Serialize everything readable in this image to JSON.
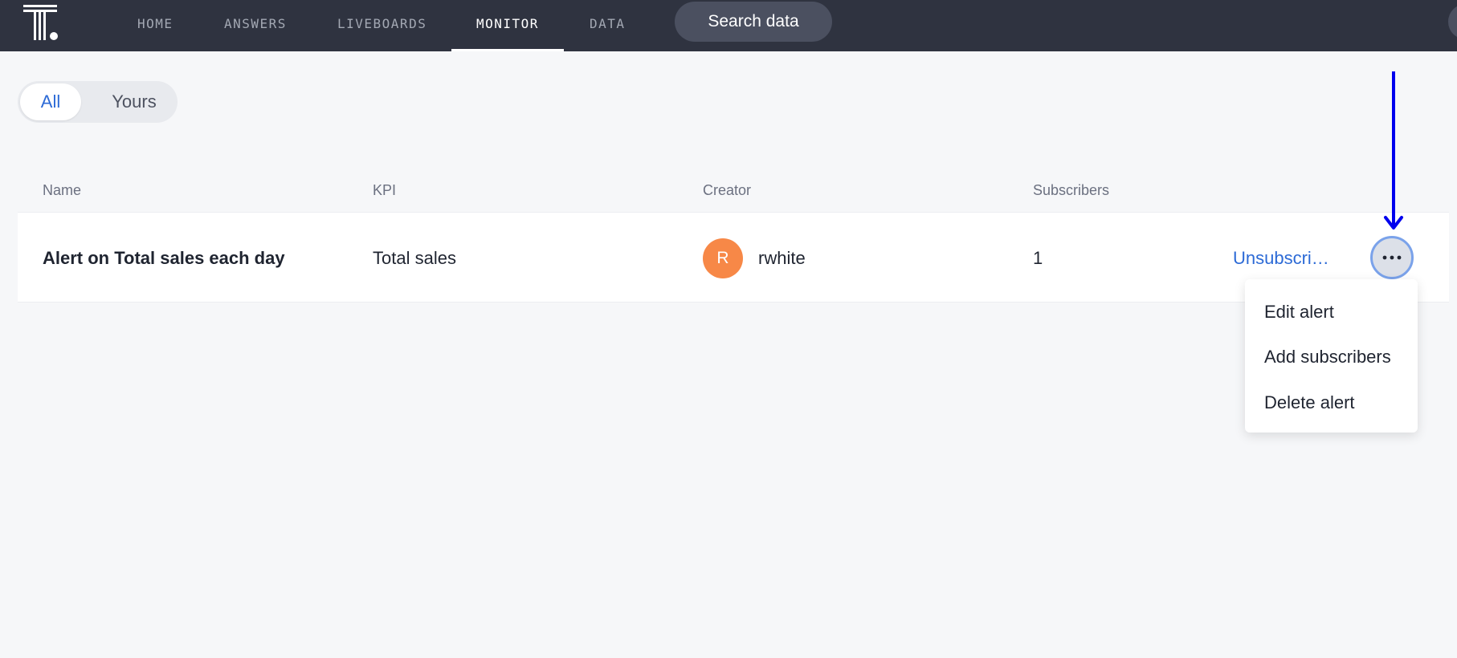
{
  "nav": {
    "tabs": [
      {
        "label": "HOME",
        "active": false
      },
      {
        "label": "ANSWERS",
        "active": false
      },
      {
        "label": "LIVEBOARDS",
        "active": false
      },
      {
        "label": "MONITOR",
        "active": true
      },
      {
        "label": "DATA",
        "active": false
      }
    ],
    "search_label": "Search data"
  },
  "filter": {
    "options": [
      "All",
      "Yours"
    ],
    "selected": "All"
  },
  "table": {
    "columns": [
      "Name",
      "KPI",
      "Creator",
      "Subscribers"
    ],
    "rows": [
      {
        "name": "Alert on Total sales each day",
        "kpi": "Total sales",
        "creator_initial": "R",
        "creator": "rwhite",
        "subscribers": "1",
        "action_label": "Unsubscri…"
      }
    ]
  },
  "more_menu": {
    "items": [
      "Edit alert",
      "Add subscribers",
      "Delete alert"
    ]
  },
  "colors": {
    "topbar": "#2f3340",
    "accent": "#2c6ad6",
    "avatar": "#f78847",
    "annotation_arrow": "#0000ee"
  },
  "icons": {
    "logo": "thoughtspot-logo",
    "more": "more-horizontal-icon",
    "annotation": "arrow-down-annotation"
  }
}
